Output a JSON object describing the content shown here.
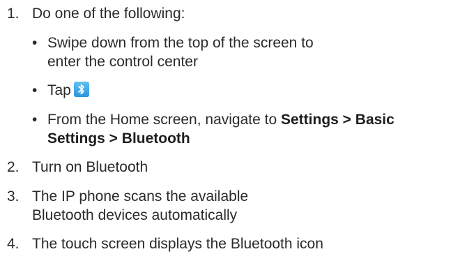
{
  "steps": [
    {
      "num": "1.",
      "text": "Do one of the following:",
      "bullets": [
        {
          "dot": "•",
          "text": "Swipe down from the top of the screen to enter the control center"
        },
        {
          "dot": "•",
          "text": "Tap",
          "icon": "bluetooth-icon"
        },
        {
          "dot": "•",
          "text_prefix": "From the Home screen, navigate to ",
          "bold": "Settings > Basic Settings > Bluetooth"
        }
      ]
    },
    {
      "num": "2.",
      "text": "Turn on Bluetooth"
    },
    {
      "num": "3.",
      "text": "The IP phone scans the available Bluetooth devices automatically"
    },
    {
      "num": "4.",
      "text": "The touch screen displays the Bluetooth icon"
    }
  ],
  "colors": {
    "text": "#2a2a2a",
    "icon_bg": "#2a95de"
  }
}
